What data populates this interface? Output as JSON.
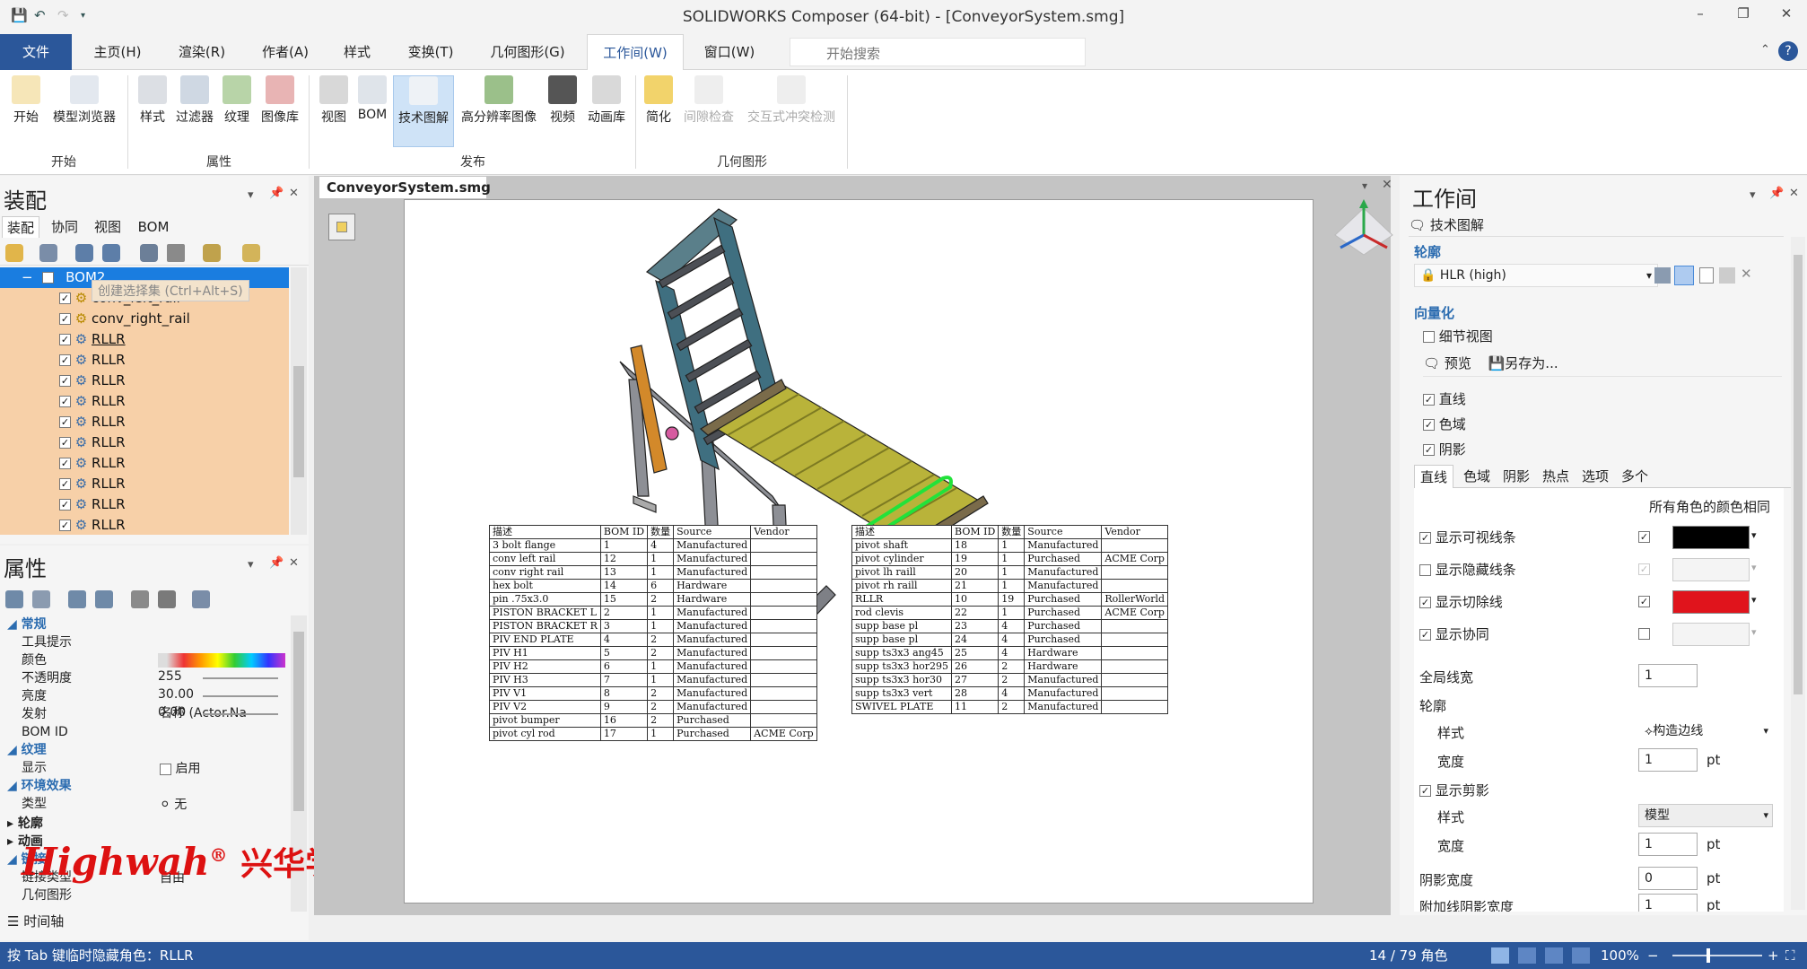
{
  "titlebar": {
    "title": "SOLIDWORKS Composer (64-bit) - [ConveyorSystem.smg]",
    "minimize": "–",
    "restore": "❐",
    "close": "✕"
  },
  "menu": {
    "file": "文件",
    "tabs": [
      "主页(H)",
      "渲染(R)",
      "作者(A)",
      "样式",
      "变换(T)",
      "几何图形(G)",
      "工作间(W)",
      "窗口(W)"
    ],
    "search_placeholder": "开始搜索"
  },
  "ribbon": {
    "buttons": [
      "开始",
      "模型浏览器",
      "样式",
      "过滤器",
      "纹理",
      "图像库",
      "视图",
      "BOM",
      "技术图解",
      "高分辨率图像",
      "视频",
      "动画库",
      "简化",
      "间隙检查",
      "交互式冲突检测"
    ],
    "groups": [
      "开始",
      "属性",
      "发布",
      "几何图形"
    ]
  },
  "assembly": {
    "title": "装配",
    "tabs": [
      "装配",
      "协同",
      "视图",
      "BOM"
    ],
    "tooltip": "创建选择集 (Ctrl+Alt+S)",
    "root": "BOM2",
    "items": [
      "conv_left_rail",
      "conv_right_rail",
      "RLLR",
      "RLLR",
      "RLLR",
      "RLLR",
      "RLLR",
      "RLLR",
      "RLLR",
      "RLLR",
      "RLLR",
      "RLLR"
    ]
  },
  "properties": {
    "title": "属性",
    "sections": {
      "general": "常规",
      "texture": "纹理",
      "env": "环境效果",
      "outline": "轮廓",
      "animation": "动画",
      "link": "链接"
    },
    "rows": {
      "tooltip_label": "工具提示",
      "tooltip_value": "名称 (Actor.Na",
      "color_label": "颜色",
      "opacity_label": "不透明度",
      "opacity_value": "255",
      "brightness_label": "亮度",
      "brightness_value": "30.00",
      "emission_label": "发射",
      "emission_value": "0.00",
      "bomid_label": "BOM ID",
      "display_label": "显示",
      "display_value": "启用",
      "type_label": "类型",
      "type_value": "无",
      "linktype_label": "链接类型",
      "linktype_value": "自由",
      "geom_label": "几何图形"
    },
    "timeline": "时间轴"
  },
  "document": {
    "tab": "ConveyorSystem.smg",
    "bom_headers": [
      "描述",
      "BOM ID",
      "数量",
      "Source",
      "Vendor"
    ],
    "bom_left": [
      [
        "3 bolt flange",
        "1",
        "4",
        "Manufactured",
        ""
      ],
      [
        "conv left rail",
        "12",
        "1",
        "Manufactured",
        ""
      ],
      [
        "conv right rail",
        "13",
        "1",
        "Manufactured",
        ""
      ],
      [
        "hex bolt",
        "14",
        "6",
        "Hardware",
        ""
      ],
      [
        "pin .75x3.0",
        "15",
        "2",
        "Hardware",
        ""
      ],
      [
        "PISTON BRACKET L",
        "2",
        "1",
        "Manufactured",
        ""
      ],
      [
        "PISTON BRACKET R",
        "3",
        "1",
        "Manufactured",
        ""
      ],
      [
        "PIV END PLATE",
        "4",
        "2",
        "Manufactured",
        ""
      ],
      [
        "PIV H1",
        "5",
        "2",
        "Manufactured",
        ""
      ],
      [
        "PIV H2",
        "6",
        "1",
        "Manufactured",
        ""
      ],
      [
        "PIV H3",
        "7",
        "1",
        "Manufactured",
        ""
      ],
      [
        "PIV V1",
        "8",
        "2",
        "Manufactured",
        ""
      ],
      [
        "PIV V2",
        "9",
        "2",
        "Manufactured",
        ""
      ],
      [
        "pivot bumper",
        "16",
        "2",
        "Purchased",
        ""
      ],
      [
        "pivot cyl rod",
        "17",
        "1",
        "Purchased",
        "ACME Corp"
      ]
    ],
    "bom_right": [
      [
        "pivot shaft",
        "18",
        "1",
        "Manufactured",
        ""
      ],
      [
        "pivot cylinder",
        "19",
        "1",
        "Purchased",
        "ACME Corp"
      ],
      [
        "pivot lh raill",
        "20",
        "1",
        "Manufactured",
        ""
      ],
      [
        "pivot rh raill",
        "21",
        "1",
        "Manufactured",
        ""
      ],
      [
        "RLLR",
        "10",
        "19",
        "Purchased",
        "RollerWorld"
      ],
      [
        "rod clevis",
        "22",
        "1",
        "Purchased",
        "ACME Corp"
      ],
      [
        "supp base pl",
        "23",
        "4",
        "Purchased",
        ""
      ],
      [
        "supp base pl",
        "24",
        "4",
        "Purchased",
        ""
      ],
      [
        "supp ts3x3 ang45",
        "25",
        "4",
        "Hardware",
        ""
      ],
      [
        "supp ts3x3 hor295",
        "26",
        "2",
        "Hardware",
        ""
      ],
      [
        "supp ts3x3 hor30",
        "27",
        "2",
        "Manufactured",
        ""
      ],
      [
        "supp ts3x3 vert",
        "28",
        "4",
        "Manufactured",
        ""
      ],
      [
        "SWIVEL PLATE",
        "11",
        "2",
        "Manufactured",
        ""
      ]
    ]
  },
  "workshop": {
    "title": "工作间",
    "subtitle": "技术图解",
    "outline_label": "轮廓",
    "outline_mode": "HLR (high)",
    "vectorize_label": "向量化",
    "detail_view": "细节视图",
    "preview": "预览",
    "save_as": "另存为...",
    "checks": [
      "直线",
      "色域",
      "阴影"
    ],
    "subtabs": [
      "直线",
      "色域",
      "阴影",
      "热点",
      "选项",
      "多个"
    ],
    "same_color": "所有角色的颜色相同",
    "line_rows": [
      "显示可视线条",
      "显示隐藏线条",
      "显示切除线",
      "显示协同"
    ],
    "global_width_label": "全局线宽",
    "global_width": "1",
    "contour_label": "轮廓",
    "style_label": "样式",
    "style_value": "构造边线",
    "width_label": "宽度",
    "width_value": "1",
    "pt": "pt",
    "show_clip": "显示剪影",
    "clip_style": "模型",
    "clip_width": "1",
    "shadow_width_label": "阴影宽度",
    "shadow_width": "0",
    "extra_label": "附加线阴影宽度",
    "extra_value": "1"
  },
  "status": {
    "hint": "按 Tab 键临时隐藏角色：RLLR",
    "count": "14 / 79 角色",
    "zoom": "100%"
  },
  "watermark": {
    "latin": "Highwah",
    "cn": "兴华学院"
  },
  "colors": {
    "accent": "#2b579a",
    "selection": "#f7d0a8",
    "visible_line": "#000000",
    "cut_line": "#e0141c"
  }
}
